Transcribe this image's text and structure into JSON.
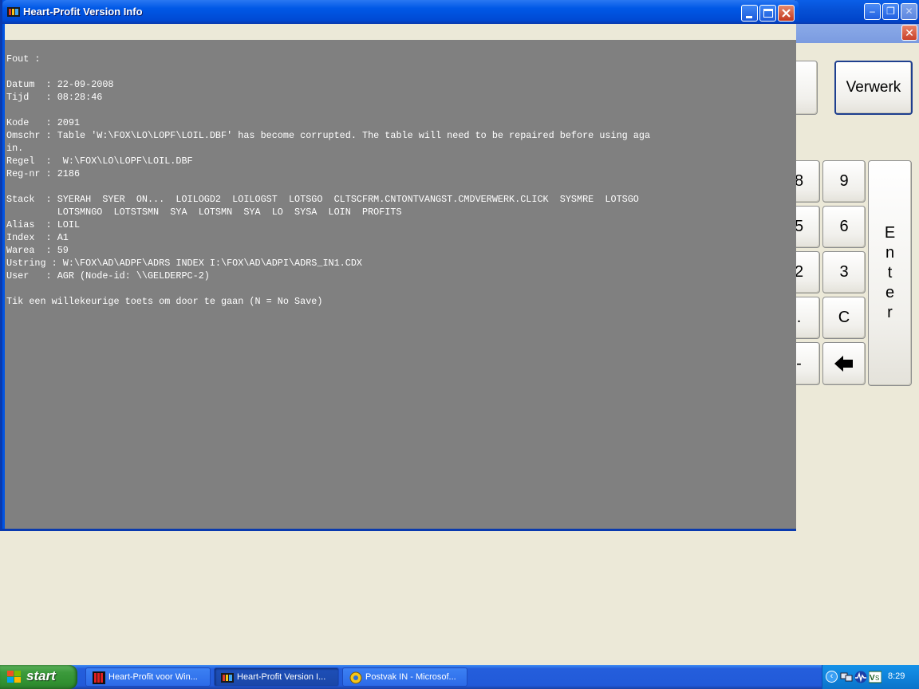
{
  "dialog": {
    "title": "Heart-Profit Version Info",
    "lines": [
      "Fout :",
      "",
      "Datum  : 22-09-2008",
      "Tijd   : 08:28:46",
      "",
      "Kode   : 2091",
      "Omschr : Table 'W:\\FOX\\LO\\LOPF\\LOIL.DBF' has become corrupted. The table will need to be repaired before using aga",
      "in.",
      "Regel  :  W:\\FOX\\LO\\LOPF\\LOIL.DBF",
      "Reg-nr : 2186",
      "",
      "Stack  : SYERAH  SYER  ON...  LOILOGD2  LOILOGST  LOTSGO  CLTSCFRM.CNTONTVANGST.CMDVERWERK.CLICK  SYSMRE  LOTSGO",
      "         LOTSMNGO  LOTSTSMN  SYA  LOTSMN  SYA  LO  SYSA  LOIN  PROFITS",
      "Alias  : LOIL",
      "Index  : A1",
      "Warea  : 59",
      "Ustring : W:\\FOX\\AD\\ADPF\\ADRS INDEX I:\\FOX\\AD\\ADPI\\ADRS_IN1.CDX",
      "User   : AGR (Node-id: \\\\GELDERPC-2)",
      "",
      "Tik een willekeurige toets om door te gaan (N = No Save)"
    ]
  },
  "app": {
    "verwerk_label": "Verwerk",
    "keys": [
      "8",
      "9",
      "5",
      "6",
      "2",
      "3",
      ".",
      "C",
      "-",
      "backspace"
    ],
    "key_labels": {
      "k8": "8",
      "k9": "9",
      "k5": "5",
      "k6": "6",
      "k2": "2",
      "k3": "3",
      "kdot": ".",
      "kc": "C",
      "kminus": "-"
    },
    "enter_letters": [
      "E",
      "n",
      "t",
      "e",
      "r"
    ]
  },
  "taskbar": {
    "start_label": "start",
    "tasks": [
      {
        "label": "Heart-Profit voor Win..."
      },
      {
        "label": "Heart-Profit Version I..."
      },
      {
        "label": "Postvak IN - Microsof..."
      }
    ],
    "clock": "8:29"
  }
}
